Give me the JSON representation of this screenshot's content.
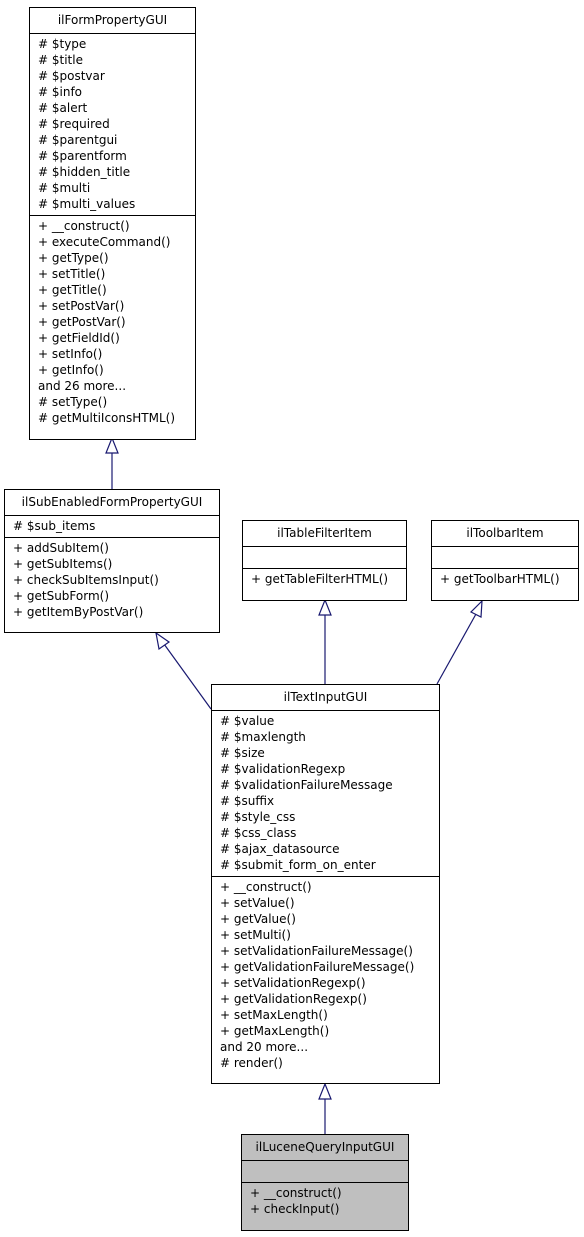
{
  "diagram": {
    "type": "uml-class-inheritance",
    "edge_color": "#191970",
    "classes": [
      {
        "id": "ilFormPropertyGUI",
        "name": "ilFormPropertyGUI",
        "attributes": [
          "# $type",
          "# $title",
          "# $postvar",
          "# $info",
          "# $alert",
          "# $required",
          "# $parentgui",
          "# $parentform",
          "# $hidden_title",
          "# $multi",
          "# $multi_values"
        ],
        "methods": [
          "+ __construct()",
          "+ executeCommand()",
          "+ getType()",
          "+ setTitle()",
          "+ getTitle()",
          "+ setPostVar()",
          "+ getPostVar()",
          "+ getFieldId()",
          "+ setInfo()",
          "+ getInfo()",
          "and 26 more...",
          "# setType()",
          "# getMultiIconsHTML()"
        ]
      },
      {
        "id": "ilSubEnabledFormPropertyGUI",
        "name": "ilSubEnabledFormPropertyGUI",
        "attributes": [
          "# $sub_items"
        ],
        "methods": [
          "+ addSubItem()",
          "+ getSubItems()",
          "+ checkSubItemsInput()",
          "+ getSubForm()",
          "+ getItemByPostVar()"
        ]
      },
      {
        "id": "ilTableFilterItem",
        "name": "ilTableFilterItem",
        "attributes": [],
        "methods": [
          "+ getTableFilterHTML()"
        ]
      },
      {
        "id": "ilToolbarItem",
        "name": "ilToolbarItem",
        "attributes": [],
        "methods": [
          "+ getToolbarHTML()"
        ]
      },
      {
        "id": "ilTextInputGUI",
        "name": "ilTextInputGUI",
        "attributes": [
          "# $value",
          "# $maxlength",
          "# $size",
          "# $validationRegexp",
          "# $validationFailureMessage",
          "# $suffix",
          "# $style_css",
          "# $css_class",
          "# $ajax_datasource",
          "# $submit_form_on_enter"
        ],
        "methods": [
          "+ __construct()",
          "+ setValue()",
          "+ getValue()",
          "+ setMulti()",
          "+ setValidationFailureMessage()",
          "+ getValidationFailureMessage()",
          "+ setValidationRegexp()",
          "+ getValidationRegexp()",
          "+ setMaxLength()",
          "+ getMaxLength()",
          "and 20 more...",
          "# render()"
        ]
      },
      {
        "id": "ilLuceneQueryInputGUI",
        "name": "ilLuceneQueryInputGUI",
        "highlighted": true,
        "attributes": [],
        "methods": [
          "+ __construct()",
          "+ checkInput()"
        ]
      }
    ],
    "inheritance": [
      {
        "child": "ilSubEnabledFormPropertyGUI",
        "parent": "ilFormPropertyGUI"
      },
      {
        "child": "ilTextInputGUI",
        "parent": "ilSubEnabledFormPropertyGUI"
      },
      {
        "child": "ilTextInputGUI",
        "parent": "ilTableFilterItem"
      },
      {
        "child": "ilTextInputGUI",
        "parent": "ilToolbarItem"
      },
      {
        "child": "ilLuceneQueryInputGUI",
        "parent": "ilTextInputGUI"
      }
    ]
  }
}
